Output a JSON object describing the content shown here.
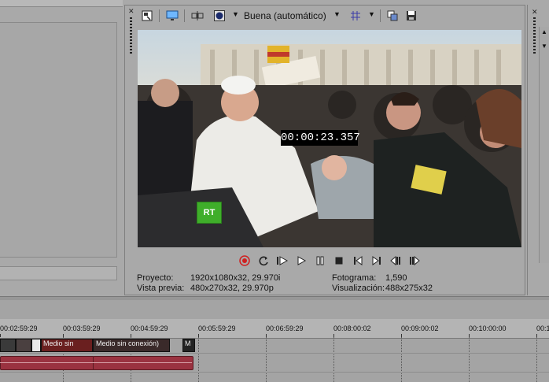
{
  "preview": {
    "quality_label": "Buena (automático)",
    "timecode": "00:00:23.357",
    "watermark": "RT"
  },
  "info": {
    "project_label": "Proyecto:",
    "project_value": "1920x1080x32, 29.970i",
    "preview_label": "Vista previa:",
    "preview_value": "480x270x32, 29.970p",
    "frame_label": "Fotograma:",
    "frame_value": "1,590",
    "display_label": "Visualización:",
    "display_value": "488x275x32"
  },
  "ruler": {
    "labels": [
      "00:02:59:29",
      "00:03:59:29",
      "00:04:59:29",
      "00:05:59:29",
      "00:06:59:29",
      "00:08:00:02",
      "00:09:00:02",
      "00:10:00:00",
      "00:1"
    ]
  },
  "timeline": {
    "clip_labels": [
      "Medio sin",
      "Medio sin conexión)",
      "M"
    ]
  },
  "colors": {
    "panel_bg": "#a9a9a9",
    "video_area": "#5a5a5a",
    "audio_clip": "#9a3240",
    "timecode_bg": "#000000",
    "rt_green": "#3fae2a"
  },
  "icons": [
    "preview-properties-icon",
    "external-monitor-icon",
    "split-screen-icon",
    "overlays-icon",
    "dropdown-arrow-icon",
    "grid-icon",
    "copy-snapshot-icon",
    "save-snapshot-icon",
    "record-icon",
    "loop-icon",
    "play-from-start-icon",
    "play-icon",
    "pause-icon",
    "stop-icon",
    "prev-frame-icon",
    "next-frame-icon",
    "prev-marker-icon",
    "next-marker-icon"
  ]
}
